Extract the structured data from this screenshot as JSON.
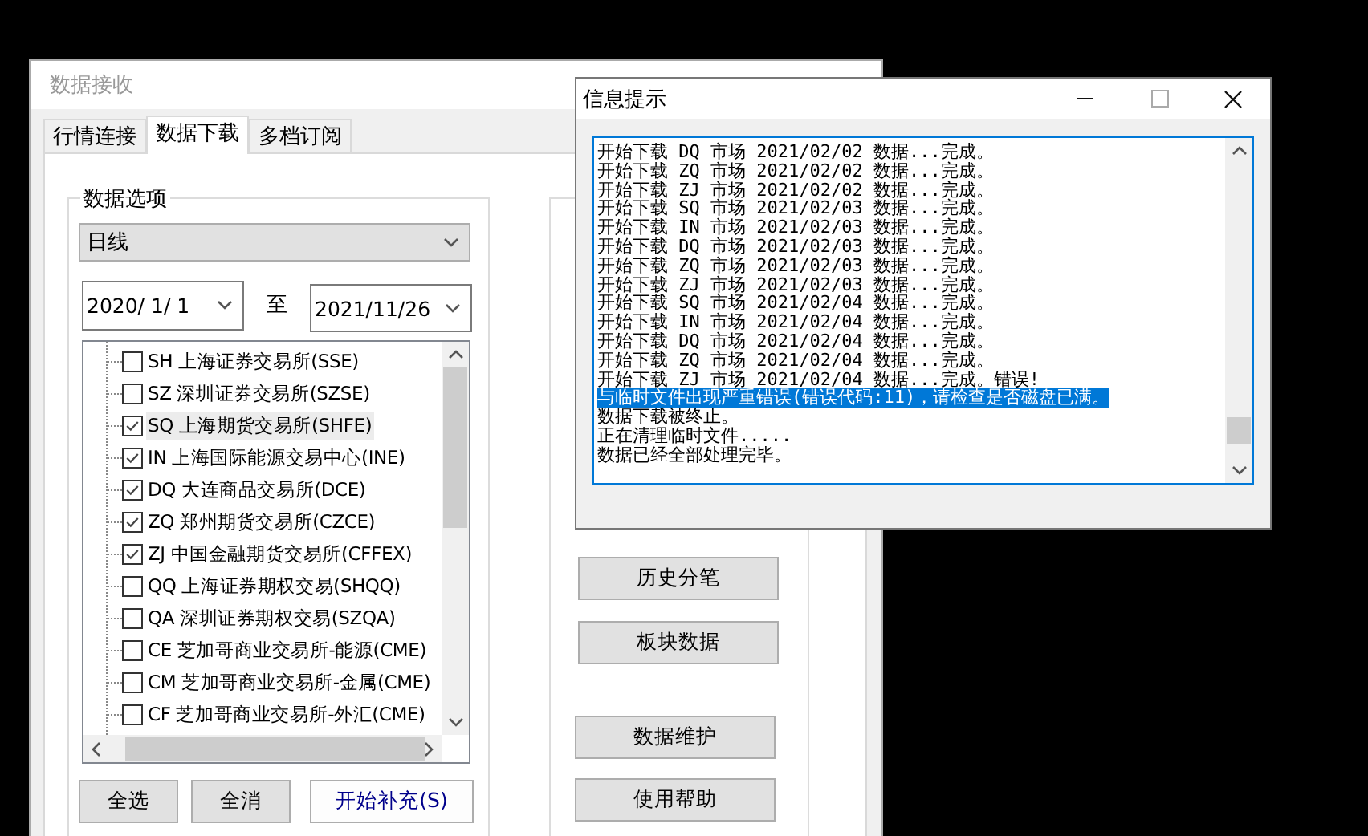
{
  "main_window": {
    "title": "数据接收",
    "active": false,
    "tabs": [
      {
        "label": "行情连接",
        "selected": false
      },
      {
        "label": "数据下载",
        "selected": true
      },
      {
        "label": "多档订阅",
        "selected": false
      }
    ],
    "data_options": {
      "title": "数据选项",
      "period": "日线",
      "date_from": "2020/ 1/ 1",
      "date_to_label": "至",
      "date_to": "2021/11/26",
      "exchanges": [
        {
          "label": "SH 上海证券交易所(SSE)",
          "checked": false,
          "selected": false
        },
        {
          "label": "SZ 深圳证券交易所(SZSE)",
          "checked": false,
          "selected": false
        },
        {
          "label": "SQ 上海期货交易所(SHFE)",
          "checked": true,
          "selected": true
        },
        {
          "label": "IN 上海国际能源交易中心(INE)",
          "checked": true,
          "selected": false
        },
        {
          "label": "DQ 大连商品交易所(DCE)",
          "checked": true,
          "selected": false
        },
        {
          "label": "ZQ 郑州期货交易所(CZCE)",
          "checked": true,
          "selected": false
        },
        {
          "label": "ZJ 中国金融期货交易所(CFFEX)",
          "checked": true,
          "selected": false
        },
        {
          "label": "QQ 上海证券期权交易(SHQQ)",
          "checked": false,
          "selected": false
        },
        {
          "label": "QA 深圳证券期权交易(SZQA)",
          "checked": false,
          "selected": false
        },
        {
          "label": "CE 芝加哥商业交易所-能源(CME)",
          "checked": false,
          "selected": false
        },
        {
          "label": "CM 芝加哥商业交易所-金属(CME)",
          "checked": false,
          "selected": false
        },
        {
          "label": "CF 芝加哥商业交易所-外汇(CME)",
          "checked": false,
          "selected": false
        }
      ],
      "buttons": [
        {
          "label": "全选",
          "kind": "normal"
        },
        {
          "label": "全消",
          "kind": "normal"
        },
        {
          "label": "开始补充(S)",
          "kind": "default"
        }
      ]
    },
    "other_buttons": [
      {
        "label": "历史分笔"
      },
      {
        "label": "板块数据"
      },
      {
        "label": "数据维护"
      },
      {
        "label": "使用帮助"
      }
    ]
  },
  "dialog": {
    "title": "信息提示",
    "active": true,
    "log": [
      {
        "text": "开始下载 DQ 市场 2021/02/02 数据...完成。",
        "selected": false
      },
      {
        "text": "开始下载 ZQ 市场 2021/02/02 数据...完成。",
        "selected": false
      },
      {
        "text": "开始下载 ZJ 市场 2021/02/02 数据...完成。",
        "selected": false
      },
      {
        "text": "开始下载 SQ 市场 2021/02/03 数据...完成。",
        "selected": false
      },
      {
        "text": "开始下载 IN 市场 2021/02/03 数据...完成。",
        "selected": false
      },
      {
        "text": "开始下载 DQ 市场 2021/02/03 数据...完成。",
        "selected": false
      },
      {
        "text": "开始下载 ZQ 市场 2021/02/03 数据...完成。",
        "selected": false
      },
      {
        "text": "开始下载 ZJ 市场 2021/02/03 数据...完成。",
        "selected": false
      },
      {
        "text": "开始下载 SQ 市场 2021/02/04 数据...完成。",
        "selected": false
      },
      {
        "text": "开始下载 IN 市场 2021/02/04 数据...完成。",
        "selected": false
      },
      {
        "text": "开始下载 DQ 市场 2021/02/04 数据...完成。",
        "selected": false
      },
      {
        "text": "开始下载 ZQ 市场 2021/02/04 数据...完成。",
        "selected": false
      },
      {
        "text": "开始下载 ZJ 市场 2021/02/04 数据...完成。错误!",
        "selected": false
      },
      {
        "text": "与临时文件出现严重错误(错误代码:11)，请检查是否磁盘已满。",
        "selected": true
      },
      {
        "text": "数据下载被终止。",
        "selected": false
      },
      {
        "text": "正在清理临时文件.....",
        "selected": false
      },
      {
        "text": "数据已经全部处理完毕。",
        "selected": false
      }
    ]
  }
}
